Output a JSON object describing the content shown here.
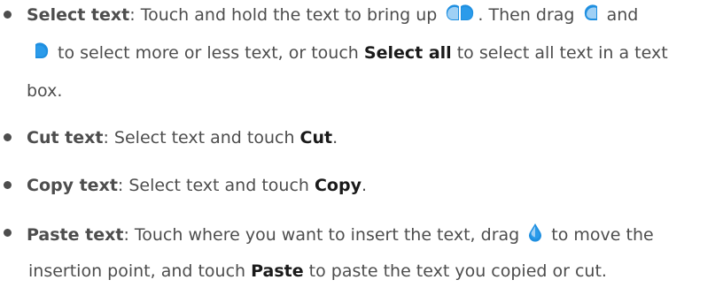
{
  "colors": {
    "text": "#4d4d4d",
    "bold_command": "#1a1a1a",
    "handle_light": "#9fd0f5",
    "handle_dark": "#1f8fe0"
  },
  "items": [
    {
      "term": "Select text",
      "line1_a": ": Touch and hold the text to bring up ",
      "line1_b": ". Then drag ",
      "line1_c": " and",
      "line2_a": " to select more or less text, or touch ",
      "line2_cmd": "Select all",
      "line2_b": " to select all text in a text",
      "line3": "box."
    },
    {
      "term": "Cut text",
      "text_a": ": Select text and touch ",
      "cmd": "Cut",
      "text_b": "."
    },
    {
      "term": "Copy text",
      "text_a": ": Select text and touch ",
      "cmd": "Copy",
      "text_b": "."
    },
    {
      "term": "Paste text",
      "line1_a": ": Touch where you want to insert the text, drag ",
      "line1_b": " to move the",
      "line2_a": "insertion point, and touch ",
      "line2_cmd": "Paste",
      "line2_b": " to paste the text you copied or cut."
    }
  ],
  "icons": {
    "selection_handles": "selection-handles-icon",
    "left_handle": "left-selection-handle-icon",
    "right_handle": "right-selection-handle-icon",
    "cursor_handle": "cursor-handle-icon"
  }
}
